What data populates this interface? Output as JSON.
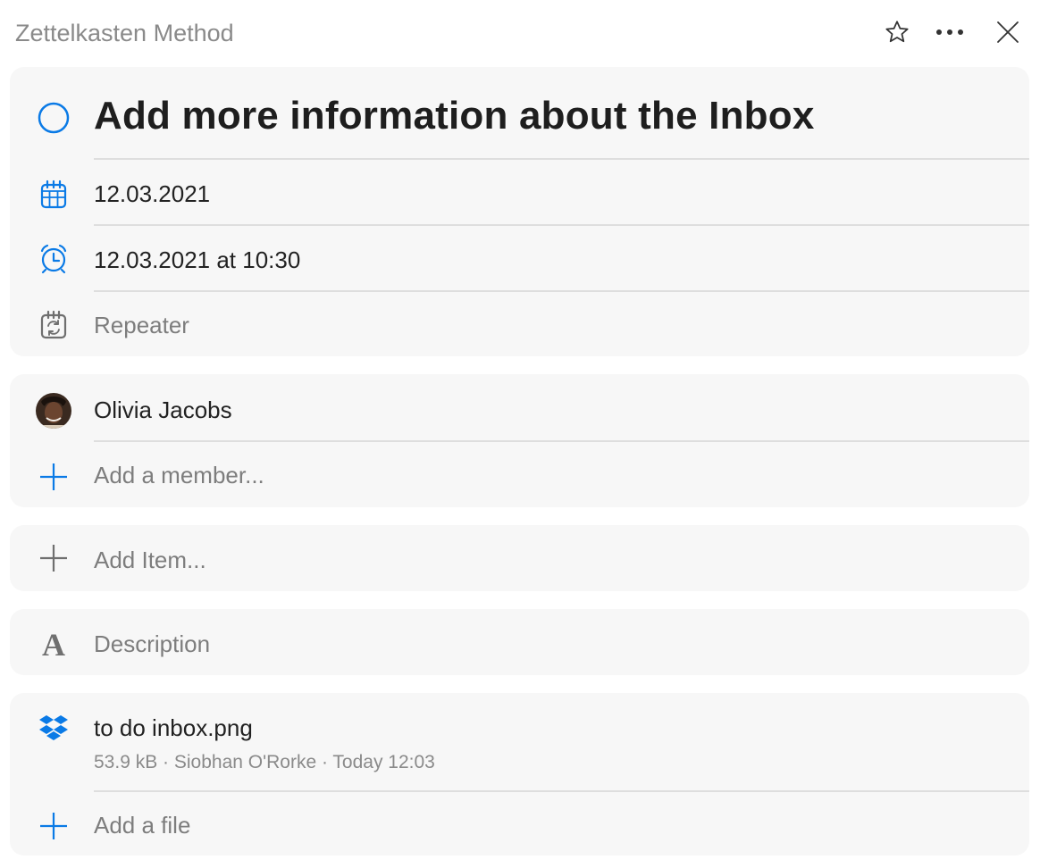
{
  "header": {
    "list_name": "Zettelkasten Method",
    "icons": [
      "star-icon",
      "more-icon",
      "close-icon"
    ]
  },
  "task": {
    "title": "Add more information about the Inbox",
    "due_date": "12.03.2021",
    "reminder": "12.03.2021 at 10:30",
    "repeater_placeholder": "Repeater"
  },
  "members": {
    "items": [
      {
        "name": "Olivia Jacobs"
      }
    ],
    "add_label": "Add a member..."
  },
  "checklist": {
    "add_label": "Add Item..."
  },
  "description": {
    "placeholder": "Description"
  },
  "files": {
    "items": [
      {
        "name": "to do inbox.png",
        "meta": "53.9 kB · Siobhan O'Rorke · Today 12:03",
        "source_icon": "dropbox-icon"
      }
    ],
    "add_label": "Add a file"
  },
  "colors": {
    "accent": "#0a7ae6",
    "card_bg": "#f7f7f7",
    "muted_text": "#7d7d7d",
    "divider": "#dedede"
  }
}
